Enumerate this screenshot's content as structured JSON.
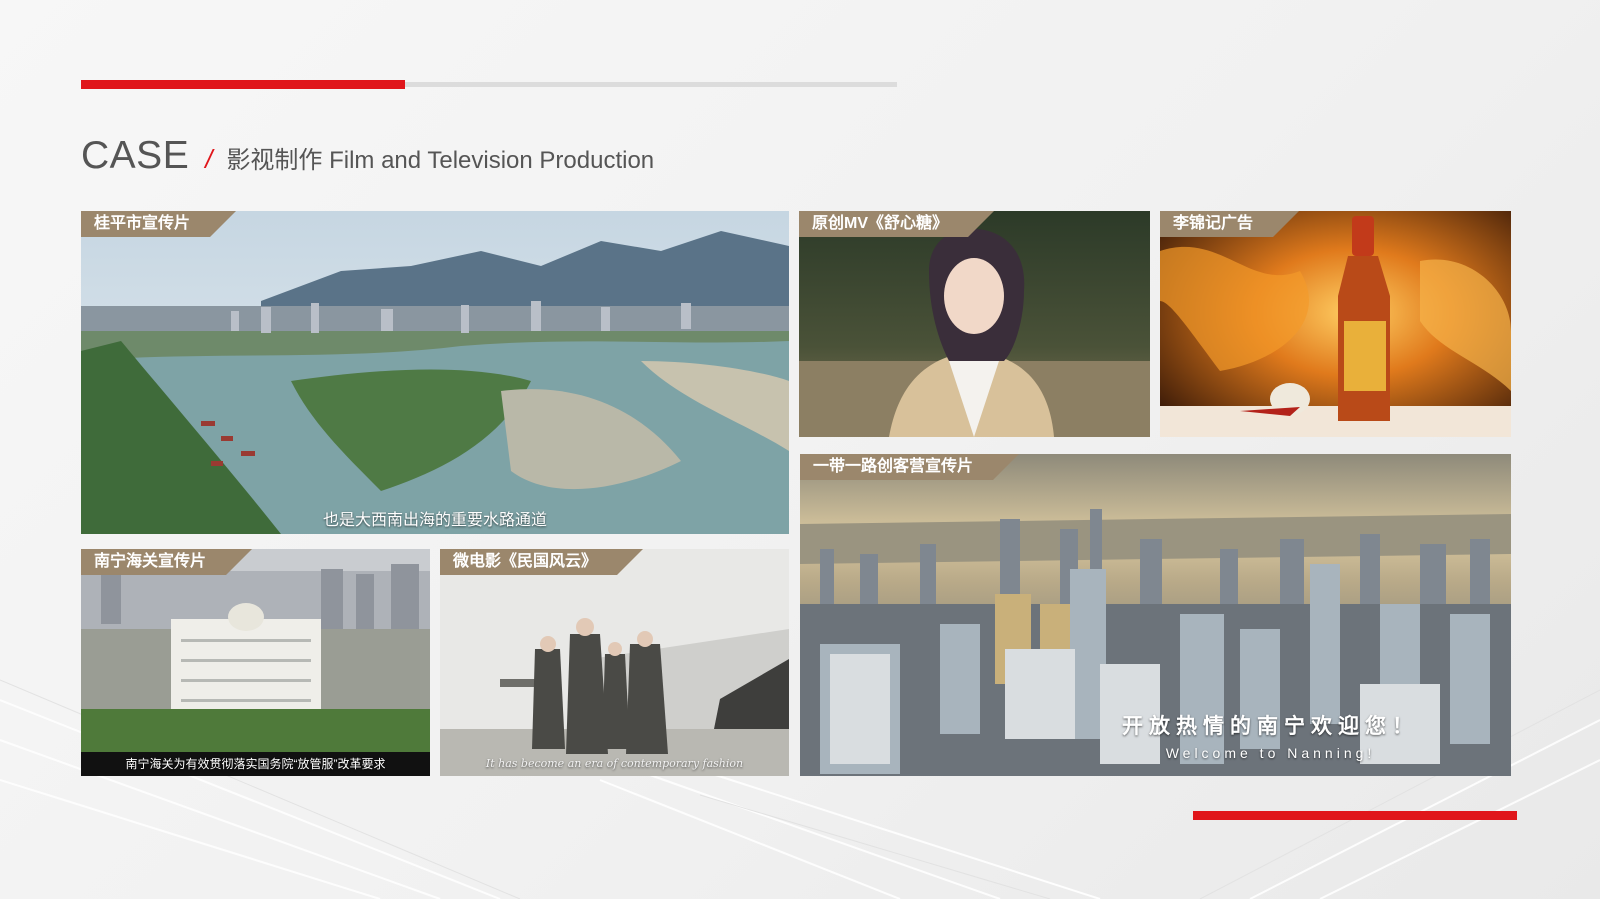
{
  "header": {
    "title": "CASE",
    "separator": "/",
    "subtitle": "影视制作 Film and Television Production"
  },
  "colors": {
    "accent": "#e0161b",
    "tag_background": "#9b876c",
    "text": "#555555"
  },
  "gallery": [
    {
      "tag": "桂平市宣传片",
      "caption": "也是大西南出海的重要水路通道"
    },
    {
      "tag": "原创MV《舒心糖》",
      "caption": ""
    },
    {
      "tag": "李锦记广告",
      "caption": ""
    },
    {
      "tag": "南宁海关宣传片",
      "caption": "南宁海关为有效贯彻落实国务院“放管服”改革要求"
    },
    {
      "tag": "微电影《民国风云》",
      "caption": "It has become an era of contemporary fashion"
    },
    {
      "tag": "一带一路创客营宣传片",
      "caption": "开放热情的南宁欢迎您！",
      "caption_en": "Welcome to Nanning!"
    }
  ]
}
